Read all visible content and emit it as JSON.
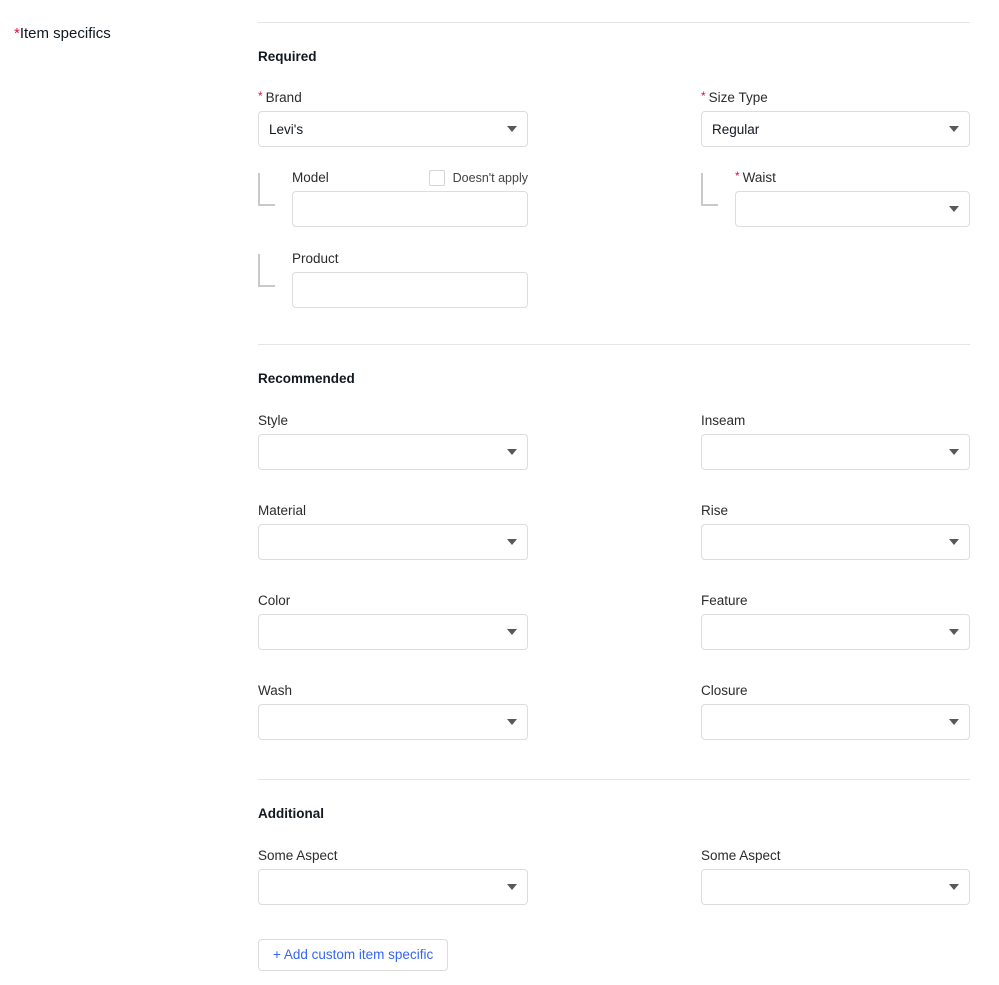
{
  "rail": {
    "required_marker": "*",
    "label": "Item specifics"
  },
  "colors": {
    "required_red": "#e0103a",
    "link_blue": "#3665f3",
    "border_gray": "#dddddd",
    "divider_gray": "#e5e5e5",
    "caret_gray": "#585858"
  },
  "sections": {
    "required": {
      "title": "Required",
      "brand": {
        "required_marker": "*",
        "label": "Brand",
        "value": "Levi's",
        "caret": "chevron-down-icon"
      },
      "size_type": {
        "required_marker": "*",
        "label": "Size Type",
        "value": "Regular",
        "caret": "chevron-down-icon"
      },
      "model": {
        "label": "Model",
        "value": "",
        "placeholder": "",
        "doesnt_apply_label": "Doesn't apply",
        "doesnt_apply_checked": false
      },
      "product": {
        "label": "Product",
        "value": "",
        "placeholder": ""
      },
      "waist": {
        "required_marker": "*",
        "label": "Waist",
        "value": "",
        "caret": "chevron-down-icon"
      }
    },
    "recommended": {
      "title": "Recommended",
      "rows": [
        {
          "left": {
            "label": "Style",
            "value": ""
          },
          "right": {
            "label": "Inseam",
            "value": ""
          }
        },
        {
          "left": {
            "label": "Material",
            "value": ""
          },
          "right": {
            "label": "Rise",
            "value": ""
          }
        },
        {
          "left": {
            "label": "Color",
            "value": ""
          },
          "right": {
            "label": "Feature",
            "value": ""
          }
        },
        {
          "left": {
            "label": "Wash",
            "value": ""
          },
          "right": {
            "label": "Closure",
            "value": ""
          }
        }
      ]
    },
    "additional": {
      "title": "Additional",
      "rows": [
        {
          "left": {
            "label": "Some Aspect",
            "value": ""
          },
          "right": {
            "label": "Some Aspect",
            "value": ""
          }
        }
      ],
      "add_custom_button": "+ Add custom item specific"
    }
  }
}
